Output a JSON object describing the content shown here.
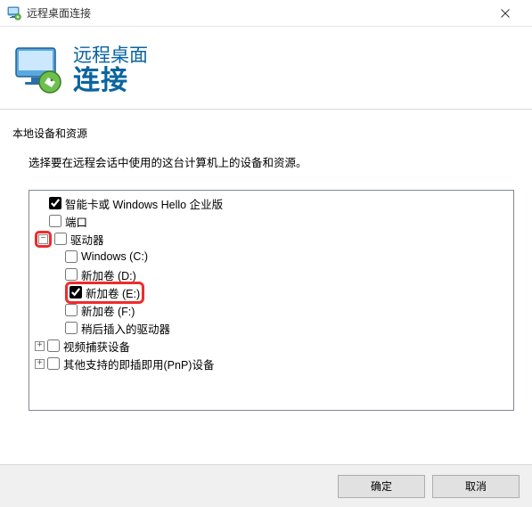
{
  "titlebar": {
    "title": "远程桌面连接"
  },
  "header": {
    "line1": "远程桌面",
    "line2": "连接"
  },
  "content": {
    "group_label": "本地设备和资源",
    "instruction": "选择要在远程会话中使用的这台计算机上的设备和资源。"
  },
  "tree": {
    "smart_card": "智能卡或 Windows Hello 企业版",
    "ports": "端口",
    "drives": "驱动器",
    "drive_c": "Windows (C:)",
    "drive_d": "新加卷 (D:)",
    "drive_e": "新加卷 (E:)",
    "drive_f": "新加卷 (F:)",
    "later_drives": "稍后插入的驱动器",
    "video_capture": "视频捕获设备",
    "pnp_devices": "其他支持的即插即用(PnP)设备"
  },
  "buttons": {
    "ok": "确定",
    "cancel": "取消"
  }
}
